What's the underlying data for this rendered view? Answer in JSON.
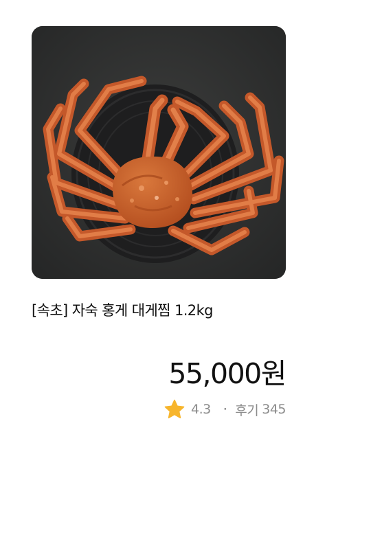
{
  "product": {
    "image_alt": "홍게 대게찜",
    "title": "[속초] 자숙 홍게 대게찜 1.2kg",
    "price": "55,000원",
    "rating": "4.3",
    "separator": "·",
    "review_label": "후기",
    "review_count": "345"
  },
  "icons": {
    "rating": "star-icon"
  },
  "colors": {
    "star": "#f7b52c",
    "muted_text": "#8b8b8b",
    "image_background": "#2f3030"
  }
}
